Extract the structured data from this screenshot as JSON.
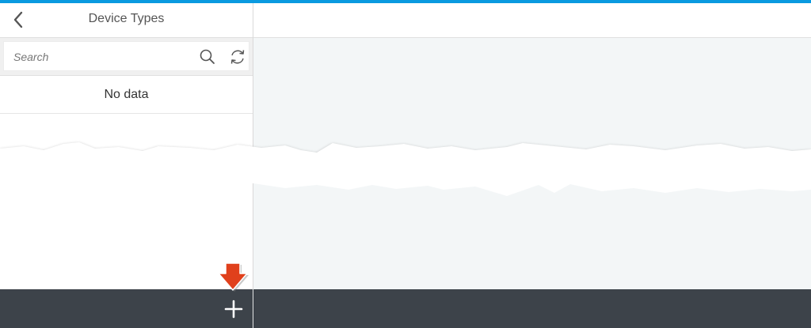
{
  "master": {
    "title": "Device Types",
    "back_icon": "chevron-left-icon",
    "search": {
      "placeholder": "Search",
      "value": "",
      "search_icon": "magnifier-icon",
      "refresh_icon": "refresh-icon"
    },
    "empty_text": "No data"
  },
  "footer": {
    "add_icon": "plus-icon"
  },
  "colors": {
    "accent": "#0a9ae0",
    "footer": "#3d434a",
    "detail_bg": "#f3f6f7",
    "pointer": "#e0401c"
  }
}
